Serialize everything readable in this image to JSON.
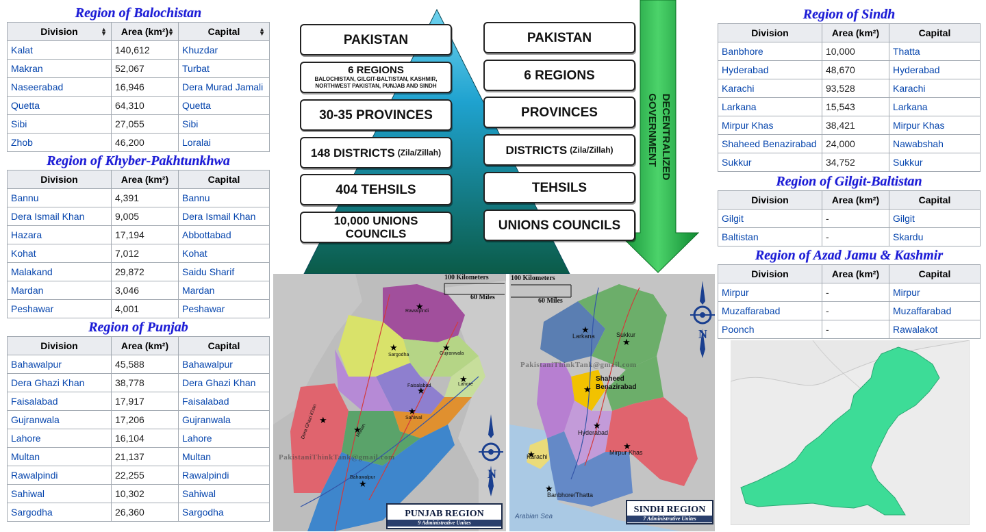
{
  "balochistan": {
    "title": "Region of Balochistan",
    "headers": [
      "Division",
      "Area (km²)",
      "Capital"
    ],
    "rows": [
      [
        "Kalat",
        "140,612",
        "Khuzdar"
      ],
      [
        "Makran",
        "52,067",
        "Turbat"
      ],
      [
        "Naseerabad",
        "16,946",
        "Dera Murad Jamali"
      ],
      [
        "Quetta",
        "64,310",
        "Quetta"
      ],
      [
        "Sibi",
        "27,055",
        "Sibi"
      ],
      [
        "Zhob",
        "46,200",
        "Loralai"
      ]
    ]
  },
  "kp": {
    "title": "Region of Khyber-Pakhtunkhwa",
    "headers": [
      "Division",
      "Area (km²)",
      "Capital"
    ],
    "rows": [
      [
        "Bannu",
        "4,391",
        "Bannu"
      ],
      [
        "Dera Ismail Khan",
        "9,005",
        "Dera Ismail Khan"
      ],
      [
        "Hazara",
        "17,194",
        "Abbottabad"
      ],
      [
        "Kohat",
        "7,012",
        "Kohat"
      ],
      [
        "Malakand",
        "29,872",
        "Saidu Sharif"
      ],
      [
        "Mardan",
        "3,046",
        "Mardan"
      ],
      [
        "Peshawar",
        "4,001",
        "Peshawar"
      ]
    ]
  },
  "punjab": {
    "title": "Region of Punjab",
    "headers": [
      "Division",
      "Area (km²)",
      "Capital"
    ],
    "rows": [
      [
        "Bahawalpur",
        "45,588",
        "Bahawalpur"
      ],
      [
        "Dera Ghazi Khan",
        "38,778",
        "Dera Ghazi Khan"
      ],
      [
        "Faisalabad",
        "17,917",
        "Faisalabad"
      ],
      [
        "Gujranwala",
        "17,206",
        "Gujranwala"
      ],
      [
        "Lahore",
        "16,104",
        "Lahore"
      ],
      [
        "Multan",
        "21,137",
        "Multan"
      ],
      [
        "Rawalpindi",
        "22,255",
        "Rawalpindi"
      ],
      [
        "Sahiwal",
        "10,302",
        "Sahiwal"
      ],
      [
        "Sargodha",
        "26,360",
        "Sargodha"
      ]
    ]
  },
  "sindh": {
    "title": "Region of Sindh",
    "headers": [
      "Division",
      "Area (km²)",
      "Capital"
    ],
    "rows": [
      [
        "Banbhore",
        "10,000",
        "Thatta"
      ],
      [
        "Hyderabad",
        "48,670",
        "Hyderabad"
      ],
      [
        "Karachi",
        "93,528",
        "Karachi"
      ],
      [
        "Larkana",
        "15,543",
        "Larkana"
      ],
      [
        "Mirpur Khas",
        "38,421",
        "Mirpur Khas"
      ],
      [
        "Shaheed Benazirabad",
        "24,000",
        "Nawabshah"
      ],
      [
        "Sukkur",
        "34,752",
        "Sukkur"
      ]
    ]
  },
  "gilgit": {
    "title": "Region of Gilgit-Baltistan",
    "headers": [
      "Division",
      "Area (km²)",
      "Capital"
    ],
    "rows": [
      [
        "Gilgit",
        "-",
        "Gilgit"
      ],
      [
        "Baltistan",
        "-",
        "Skardu"
      ]
    ]
  },
  "ajk": {
    "title": "Region of Azad Jamu & Kashmir",
    "headers": [
      "Division",
      "Area (km²)",
      "Capital"
    ],
    "rows": [
      [
        "Mirpur",
        "-",
        "Mirpur"
      ],
      [
        "Muzaffarabad",
        "-",
        "Muzaffarabad"
      ],
      [
        "Poonch",
        "-",
        "Rawalakot"
      ]
    ]
  },
  "pyramid_left": {
    "l1": "PAKISTAN",
    "l2": "6 REGIONS",
    "l2_sub1": "BALOCHISTAN, GILGIT-BALTISTAN, KASHMIR,",
    "l2_sub2": "NORTHWEST PAKISTAN, PUNJAB AND SINDH",
    "l3": "30-35 PROVINCES",
    "l4": "148 DISTRICTS",
    "l4_sub": "(Zila/Zillah)",
    "l5": "404 TEHSILS",
    "l6a": "10,000 UNIONS",
    "l6b": "COUNCILS"
  },
  "pyramid_right": {
    "l1": "PAKISTAN",
    "l2": "6 REGIONS",
    "l3": "PROVINCES",
    "l4": "DISTRICTS",
    "l4_sub": "(Zila/Zillah)",
    "l5": "TEHSILS",
    "l6": "UNIONS COUNCILS",
    "arrow_text_1": "DECENTRALIZED",
    "arrow_text_2": "GOVERNMENT"
  },
  "punjab_map": {
    "scale_km": "100 Kilometers",
    "scale_mi": "60 Miles",
    "watermark": "PakistaniThinkTank@gmail.com",
    "badge_title": "PUNJAB REGION",
    "badge_sub": "9 Administrative Unites",
    "compass": "N",
    "cities": [
      "Rawalpindi",
      "Sargodha",
      "Gujranwala",
      "Faisalabad",
      "Lahore",
      "Sahiwal",
      "Dera Ghazi Khan",
      "Multan",
      "Bahawalpur"
    ]
  },
  "sindh_map": {
    "scale_km": "100 Kilometers",
    "scale_mi": "60 Miles",
    "watermark": "PakistaniThinkTank@gmail.com",
    "badge_title": "SINDH REGION",
    "badge_sub": "7 Administrative Unites",
    "compass": "N",
    "sea_label": "Arabian Sea",
    "cities": [
      "Larkana",
      "Sukkur",
      "Shaheed",
      "Benazirabad",
      "Hyderabad",
      "Karachi",
      "Mirpur Khas",
      "Banbhore/Thatta"
    ]
  },
  "colors": {
    "link": "#0645ad",
    "title_blue": "#1c1cd6",
    "header_bg": "#eaecf0",
    "pakistan_green": "#3ddc97",
    "arrow_green": "#1fae4a"
  }
}
